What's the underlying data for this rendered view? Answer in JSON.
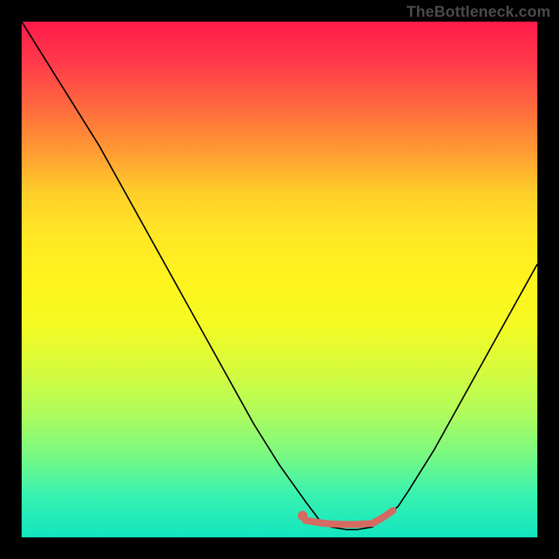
{
  "watermark": "TheBottleneck.com",
  "chart_data": {
    "type": "line",
    "title": "",
    "xlabel": "",
    "ylabel": "",
    "xlim": [
      0,
      100
    ],
    "ylim": [
      0,
      100
    ],
    "background_gradient": [
      "#ff1a4a",
      "#ff3c4a",
      "#ff6a3e",
      "#ff9a32",
      "#ffcf2a",
      "#ffe824",
      "#fff31e",
      "#f5fa22",
      "#d9fb3a",
      "#b5fc58",
      "#7ef97e",
      "#39f2b0",
      "#12e5c0"
    ],
    "series": [
      {
        "name": "bottleneck-curve",
        "color": "#000000",
        "stroke_width": 2,
        "x": [
          0,
          5,
          10,
          15,
          20,
          25,
          30,
          35,
          40,
          45,
          50,
          55,
          58,
          60,
          63,
          65,
          68,
          70,
          73,
          75,
          80,
          85,
          90,
          95,
          100
        ],
        "values": [
          100,
          92,
          84,
          76,
          67,
          58,
          49,
          40,
          31,
          22,
          14,
          7,
          3,
          2,
          1.5,
          1.5,
          2,
          3.5,
          6,
          9,
          17,
          26,
          35,
          44,
          53
        ]
      },
      {
        "name": "highlight-segment",
        "color": "#d46a62",
        "stroke_width": 10,
        "linecap": "round",
        "x": [
          55,
          58,
          60,
          63,
          65,
          68,
          70,
          72
        ],
        "values": [
          3.3,
          2.8,
          2.6,
          2.5,
          2.5,
          2.7,
          3.8,
          5.2
        ]
      },
      {
        "name": "highlight-dot",
        "type": "scatter",
        "color": "#d46a62",
        "r": 7,
        "x": [
          54.5
        ],
        "values": [
          4.2
        ]
      }
    ]
  }
}
